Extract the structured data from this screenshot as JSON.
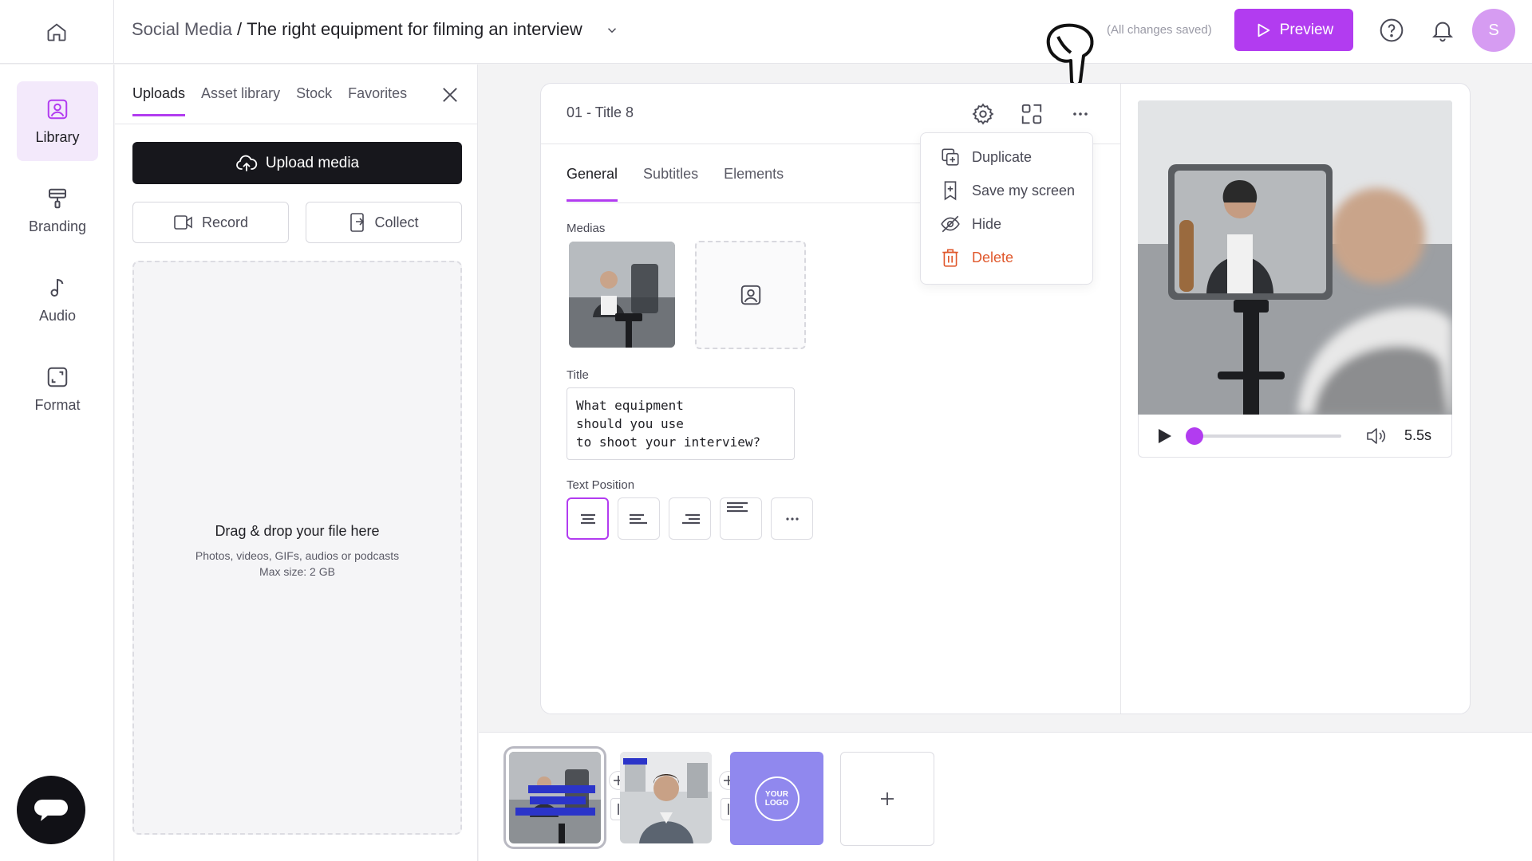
{
  "header": {
    "breadcrumb_parent": "Social Media",
    "breadcrumb_separator": "/",
    "breadcrumb_current": "The right equipment for filming an interview",
    "save_status": "(All changes saved)",
    "preview_label": "Preview",
    "avatar_initial": "S",
    "icons": [
      "home-icon",
      "chevron-down-icon",
      "play-icon",
      "help-icon",
      "bell-icon",
      "pointer-hand-icon"
    ]
  },
  "sidebar": {
    "items": [
      {
        "label": "Library",
        "icon": "image-icon",
        "active": true
      },
      {
        "label": "Branding",
        "icon": "paint-roller-icon"
      },
      {
        "label": "Audio",
        "icon": "music-note-icon"
      },
      {
        "label": "Format",
        "icon": "resize-icon"
      }
    ],
    "chat_icon": "chat-icon"
  },
  "library": {
    "tabs": [
      {
        "label": "Uploads",
        "active": true
      },
      {
        "label": "Asset library"
      },
      {
        "label": "Stock"
      },
      {
        "label": "Favorites"
      }
    ],
    "upload_label": "Upload media",
    "record_label": "Record",
    "collect_label": "Collect",
    "dropzone": {
      "title": "Drag & drop your file here",
      "subtitle": "Photos, videos, GIFs, audios or podcasts",
      "max_size": "Max size: 2 GB"
    }
  },
  "editor": {
    "scene_title": "01 - Title 8",
    "tabs": [
      {
        "label": "General",
        "active": true
      },
      {
        "label": "Subtitles"
      },
      {
        "label": "Elements"
      }
    ],
    "medias_label": "Medias",
    "title_label": "Title",
    "title_value": "What equipment\nshould you use\nto shoot your interview?",
    "text_position_label": "Text Position",
    "text_positions": [
      "align-center-icon",
      "align-left-icon",
      "align-right-icon",
      "align-top-left-icon",
      "more-icon"
    ]
  },
  "menu": {
    "items": [
      {
        "label": "Duplicate",
        "icon": "duplicate-icon"
      },
      {
        "label": "Save my screen",
        "icon": "bookmark-icon"
      },
      {
        "label": "Hide",
        "icon": "eye-off-icon"
      },
      {
        "label": "Delete",
        "icon": "trash-icon",
        "danger": true
      }
    ]
  },
  "player": {
    "duration": "5.5s",
    "progress": 0.0
  },
  "timeline": {
    "scene1_caption": "What equipment should you use to shoot your interview?",
    "logo_text": "YOUR LOGO",
    "add_label": "+"
  },
  "colors": {
    "accent": "#b23cf0",
    "danger": "#e0582c",
    "logo_card": "#9088ee"
  }
}
